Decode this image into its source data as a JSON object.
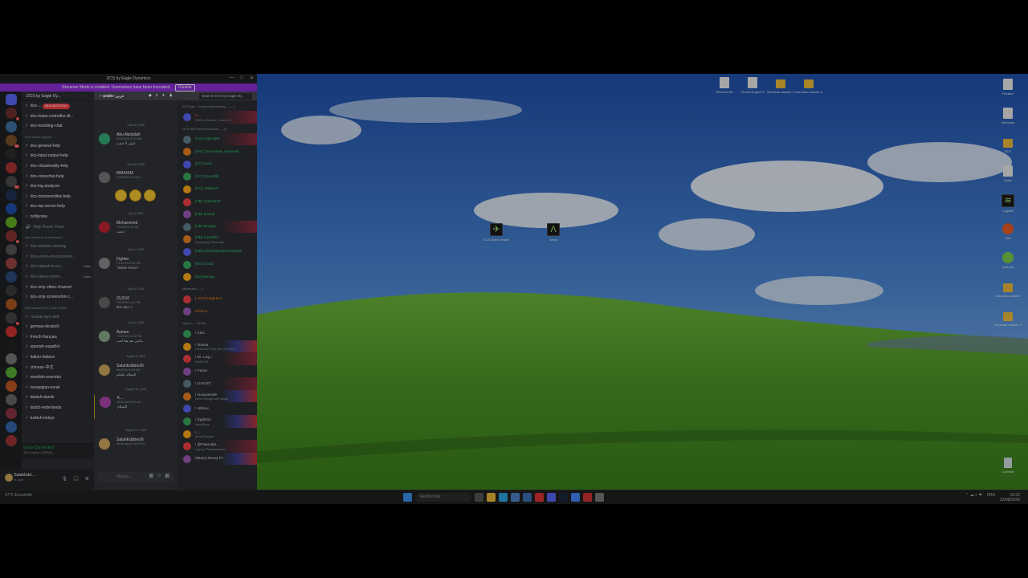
{
  "window": {
    "title": "DCS by Eagle Dynamics",
    "controls": [
      "—",
      "□",
      "✕"
    ]
  },
  "banner": {
    "text": "Streamer Mode is enabled. Usernames have been truncated.",
    "action": "Disable"
  },
  "server": {
    "name": "DCS by Eagle Dy...",
    "unread_badges": [
      "1",
      "33",
      "37",
      "6",
      "1"
    ]
  },
  "channels": {
    "tooltip": "NEW MENTIONS",
    "top": [
      {
        "label": "dcs-..."
      },
      {
        "label": "dcs-hotas-controller-di..."
      },
      {
        "label": "dcs-modding-chat"
      }
    ],
    "cat1": "DCS World Support",
    "support": [
      {
        "label": "dcs-general-help"
      },
      {
        "label": "dcs-input-output-help"
      },
      {
        "label": "dcs-virtualreality-help"
      },
      {
        "label": "dcs-voicechat-help"
      },
      {
        "label": "dcs-log-analyzer"
      },
      {
        "label": "dcs-missioneditor-help"
      },
      {
        "label": "dcs-mp-server-help"
      },
      {
        "label": "noflyzone"
      },
      {
        "label": "Help Room Voice"
      }
    ],
    "cat2": "Info channels on discussion",
    "info": [
      {
        "label": "dcs-mission-sharing",
        "count": ""
      },
      {
        "label": "dcs-event-announceme...",
        "count": ""
      },
      {
        "label": "dcs-squad-recrui...",
        "count": "3 New"
      },
      {
        "label": "dcs-server-prom...",
        "count": "2 New"
      },
      {
        "label": "dcs-only-video-channel",
        "count": ""
      },
      {
        "label": "dcs-only-screenshot-c...",
        "count": ""
      }
    ],
    "cat3": "International DCS Chat Rooms",
    "intl": [
      {
        "label": "russian-русский"
      },
      {
        "label": "german-deutsch"
      },
      {
        "label": "french-français"
      },
      {
        "label": "spanish-español"
      },
      {
        "label": "italian-italiano"
      },
      {
        "label": "chinese-中文"
      },
      {
        "label": "swedish-svenska"
      },
      {
        "label": "norwegian-norsk"
      },
      {
        "label": "danish-dansk"
      },
      {
        "label": "dutch-nederlands"
      },
      {
        "label": "turkish-türkçe"
      }
    ]
  },
  "voice": {
    "status": "Voice Connected",
    "sub": "The-Crypto / DRIMA..."
  },
  "user": {
    "name": "SalahEdd...",
    "status": "In voice"
  },
  "chat": {
    "channel": "arabic-عربي",
    "search_placeholder": "Search DCS by Eagle Dy...",
    "composer_placeholder": "Messa...",
    "messages": [
      {
        "date": "June 16, 2026",
        "user": "Abu Abdullah",
        "time": "6/16/2026 10:10 AM",
        "text": "انشر لا خفت"
      },
      {
        "date": "June 26, 2026",
        "user": "IBRAHIM",
        "time": "6/26/2026 9:03 AM",
        "text": ""
      },
      {
        "date": "July 4, 2026",
        "user": "Mohammed",
        "time": "7/4/2026 1:31 AM",
        "text": "ابحث"
      },
      {
        "date": "July 14, 2026",
        "user": "Fighter",
        "time": "7/14/2026 6:09 PM",
        "text": "\"Strike Force\""
      },
      {
        "date": "July 20, 2026",
        "user": "ZUZU0",
        "time": "7/20/2026 7:49 PM",
        "text": "dcs duo ?"
      },
      {
        "date": "July 24, 2026",
        "user": "Ayman",
        "time": "7/24/2026 11:59 PM",
        "text": "ماعي بعد هنا لعب"
      },
      {
        "date": "August 6, 2026",
        "user": "SalahEddine26",
        "time": "8/6/2026 10:05 AM",
        "text": "السلام عليكم"
      },
      {
        "date": "August 16, 2026",
        "user": "K...",
        "time": "8/16/2026 6:42 AM",
        "text": "السلام"
      },
      {
        "date": "August 21, 2026",
        "user": "SalahEddine26",
        "time": "Yesterday at 10:29 PM",
        "text": ""
      }
    ]
  },
  "members": {
    "sections": [
      {
        "title": "ED Team - Community Manag... — 1",
        "items": [
          {
            "name": "N... ",
            "status": "100% of the time, it works 6...",
            "color": "#f23f43",
            "style": "nitro"
          }
        ]
      },
      {
        "title": "DCS 3rd Party Developer — 12",
        "items": [
          {
            "name": "[AS] Asphodel",
            "status": "",
            "color": "#2dc770",
            "style": "nitro"
          },
          {
            "name": "[ASC] someone_someeth...",
            "status": "",
            "color": "#2dc770",
            "style": ""
          },
          {
            "name": "[GC] Aero",
            "status": "",
            "color": "#2dc770",
            "style": ""
          },
          {
            "name": "[GC] Greenfill",
            "status": "",
            "color": "#2dc770",
            "style": ""
          },
          {
            "name": "[GC] JNelson",
            "status": "",
            "color": "#2dc770",
            "style": ""
          },
          {
            "name": "[HB] Cobra847",
            "status": "",
            "color": "#2dc770",
            "style": ""
          },
          {
            "name": "[HB] DavidI",
            "status": "",
            "color": "#2dc770",
            "style": ""
          },
          {
            "name": "[HB] Brogan...",
            "status": "",
            "color": "#2dc770",
            "style": "nitro"
          },
          {
            "name": "[HB] IronMike",
            "status": "Keep flying, Never stop",
            "color": "#2dc770",
            "style": ""
          },
          {
            "name": "[HB] Klinkdujavatomilelojoe",
            "status": "",
            "color": "#2dc770",
            "style": ""
          },
          {
            "name": "[RS] Grind",
            "status": "",
            "color": "#2dc770",
            "style": ""
          },
          {
            "name": "[SA] Bungo",
            "status": "",
            "color": "#2dc770",
            "style": ""
          }
        ]
      },
      {
        "title": "Moderator — 2",
        "items": [
          {
            "name": "[..ED] EagleEye",
            "status": "",
            "color": "#e67e22",
            "style": ""
          },
          {
            "name": "Killshot",
            "status": "",
            "color": "#e67e22",
            "style": ""
          }
        ]
      },
      {
        "title": "Online — 10305",
        "items": [
          {
            "name": "! Alex.",
            "status": "",
            "color": "#dbdee1",
            "style": ""
          },
          {
            "name": "! D3vas",
            "status": "Cocknmoa, Pray Fire, OG Vanq...",
            "color": "#dbdee1",
            "style": "flag"
          },
          {
            "name": "! Dr. Lag !",
            "status": "MOBILICE",
            "color": "#dbdee1",
            "style": "nitro"
          },
          {
            "name": "! Fares",
            "status": "",
            "color": "#dbdee1",
            "style": ""
          },
          {
            "name": "! GHOST",
            "status": "",
            "color": "#dbdee1",
            "style": "nitro"
          },
          {
            "name": "! Guacamole",
            "status": "Arma Reforger with Medal",
            "color": "#dbdee1",
            "style": "flag"
          },
          {
            "name": "! Hfdoui",
            "status": "",
            "color": "#dbdee1",
            "style": ""
          },
          {
            "name": "! Zyphrxn",
            "status": "Hide&Seek",
            "color": "#dbdee1",
            "style": "flag"
          },
          {
            "name": "! ...",
            "status": "Arma Reforger",
            "color": "#dbdee1",
            "style": ""
          },
          {
            "name": "! @Pascobo...",
            "status": "I get up \"Pleasantwilson...",
            "color": "#dbdee1",
            "style": "nitro"
          },
          {
            "name": "!(Ravi) Reza) F'r...",
            "status": "",
            "color": "#dbdee1",
            "style": "flag"
          }
        ]
      }
    ]
  },
  "desktop": {
    "top_icons": [
      {
        "label": "Shortcut file",
        "kind": "file"
      },
      {
        "label": "Unreal Engine 5",
        "kind": "file"
      },
      {
        "label": "Nouveau dossier 2",
        "kind": "folder"
      },
      {
        "label": "Nouveau dossier 3",
        "kind": "folder"
      }
    ],
    "center_icons": [
      {
        "label": "DCS World Stable",
        "kind": "app"
      },
      {
        "label": "Arma",
        "kind": "app"
      }
    ],
    "right_icons": [
      {
        "label": "Fichiers",
        "kind": "file"
      },
      {
        "label": "Nouveau",
        "kind": "file"
      },
      {
        "label": "DCS",
        "kind": "folder"
      },
      {
        "label": "Notes",
        "kind": "file"
      },
      {
        "label": "Logiciel",
        "kind": "app"
      },
      {
        "label": "Osu",
        "kind": "app2"
      },
      {
        "label": "Android",
        "kind": "app3"
      },
      {
        "label": "Nouveau dossier",
        "kind": "folder"
      },
      {
        "label": "Nouveau dossier 5",
        "kind": "folder"
      }
    ],
    "bin_label": "Corbeille"
  },
  "taskbar": {
    "weather": "27°C Ensoleillé",
    "search_placeholder": "Rechercher",
    "lang": "FRA",
    "time": "10:52",
    "date": "22/08/2026"
  },
  "colors": {
    "discord_bg": "#2b2d31",
    "rail_bg": "#1e1f22",
    "banner": "#8b2fd6",
    "sky": "#2f6fc5",
    "grass": "#4f9a2a"
  }
}
